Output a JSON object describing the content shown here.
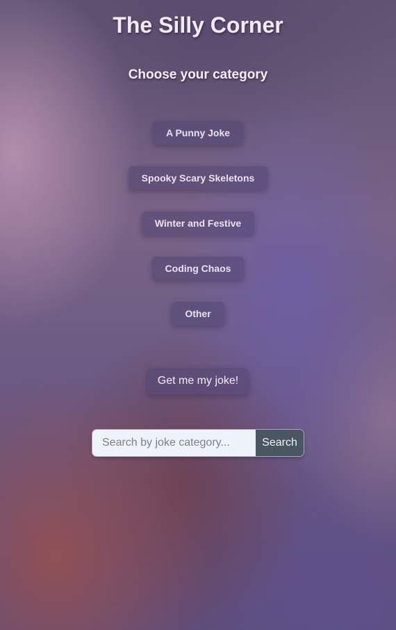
{
  "header": {
    "title": "The Silly Corner",
    "subtitle": "Choose your category"
  },
  "categories": [
    {
      "label": "A Punny Joke"
    },
    {
      "label": "Spooky Scary Skeletons"
    },
    {
      "label": "Winter and Festive"
    },
    {
      "label": "Coding Chaos"
    },
    {
      "label": "Other"
    }
  ],
  "actions": {
    "get_joke_label": "Get me my joke!"
  },
  "search": {
    "placeholder": "Search by joke category...",
    "value": "",
    "button_label": "Search"
  }
}
